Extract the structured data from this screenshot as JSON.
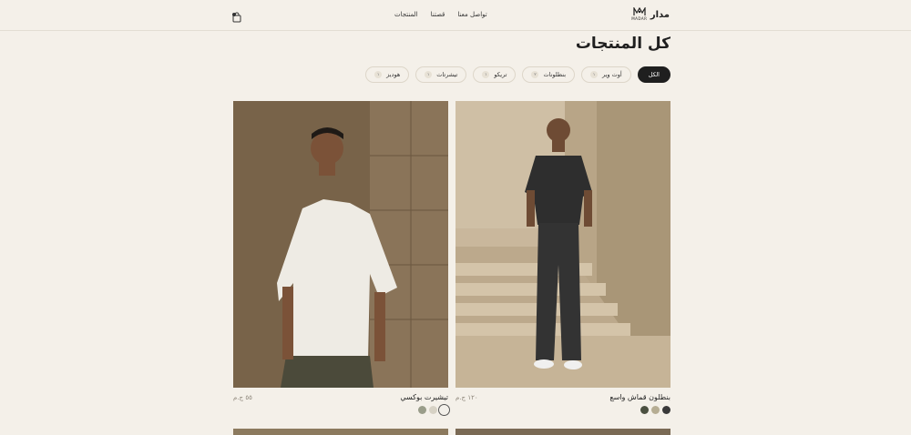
{
  "header": {
    "brand_name": "مدار",
    "logo_text": "MADAR",
    "nav": [
      "المنتجات",
      "قصتنا",
      "تواصل معنا"
    ],
    "cart_icon": "bag-icon"
  },
  "page_title": "كل المنتجات",
  "filters": [
    {
      "label": "الكل",
      "count": "",
      "active": true
    },
    {
      "label": "أوت وير",
      "count": "١",
      "active": false
    },
    {
      "label": "بنطلونات",
      "count": "٢",
      "active": false
    },
    {
      "label": "تريكو",
      "count": "١",
      "active": false
    },
    {
      "label": "تيشرتات",
      "count": "١",
      "active": false
    },
    {
      "label": "هوديز",
      "count": "١",
      "active": false
    }
  ],
  "products": [
    {
      "name": "بنطلون قماش واسع",
      "price": "١٢٠ ج.م",
      "swatches": [
        "#3a3a3a",
        "#b6ad93",
        "#4b5040"
      ]
    },
    {
      "name": "تيشيرت بوكسي",
      "price": "٥٥ ج.م",
      "swatches": [
        "#f3f0ea",
        "#d7d2c5",
        "#9a9d8a"
      ]
    }
  ],
  "colors": {
    "background": "#f4f0e9",
    "accent": "#1f1f1f"
  }
}
